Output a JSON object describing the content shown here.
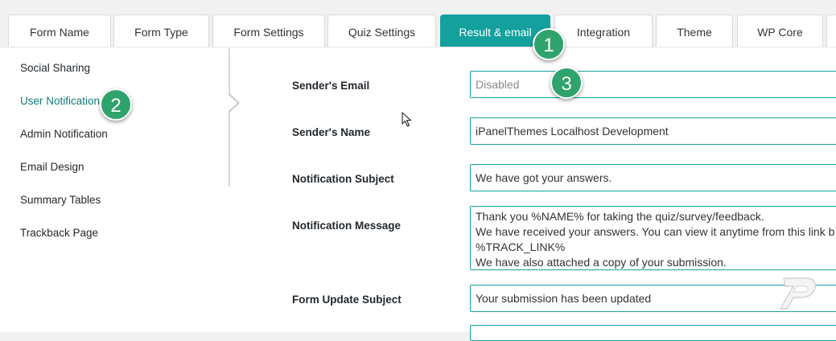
{
  "tabs": [
    {
      "label": "Form Name"
    },
    {
      "label": "Form Type"
    },
    {
      "label": "Form Settings"
    },
    {
      "label": "Quiz Settings"
    },
    {
      "label": "Result & email"
    },
    {
      "label": "Integration"
    },
    {
      "label": "Theme"
    },
    {
      "label": "WP Core"
    }
  ],
  "active_tab": "Result & email",
  "sidebar": {
    "items": [
      {
        "label": "Social Sharing"
      },
      {
        "label": "User Notification"
      },
      {
        "label": "Admin Notification"
      },
      {
        "label": "Email Design"
      },
      {
        "label": "Summary Tables"
      },
      {
        "label": "Trackback Page"
      }
    ],
    "active": "User Notification"
  },
  "form": {
    "senders_email": {
      "label": "Sender's Email",
      "value": "",
      "placeholder": "Disabled"
    },
    "senders_name": {
      "label": "Sender's Name",
      "value": "iPanelThemes Localhost Development"
    },
    "notification_subject": {
      "label": "Notification Subject",
      "value": "We have got your answers."
    },
    "notification_message": {
      "label": "Notification Message",
      "value": "Thank you %NAME% for taking the quiz/survey/feedback.\nWe have received your answers. You can view it anytime from this link b\n%TRACK_LINK%\nWe have also attached a copy of your submission."
    },
    "form_update_subject": {
      "label": "Form Update Subject",
      "value": "Your submission has been updated"
    }
  },
  "markers": [
    "1",
    "2",
    "3"
  ],
  "colors": {
    "accent": "#14a19e",
    "marker": "#2fa36c",
    "active_link": "#14797a"
  },
  "icons": {
    "cursor": "mouse-pointer-icon",
    "logo": "ipanelthemes-logo-icon"
  }
}
